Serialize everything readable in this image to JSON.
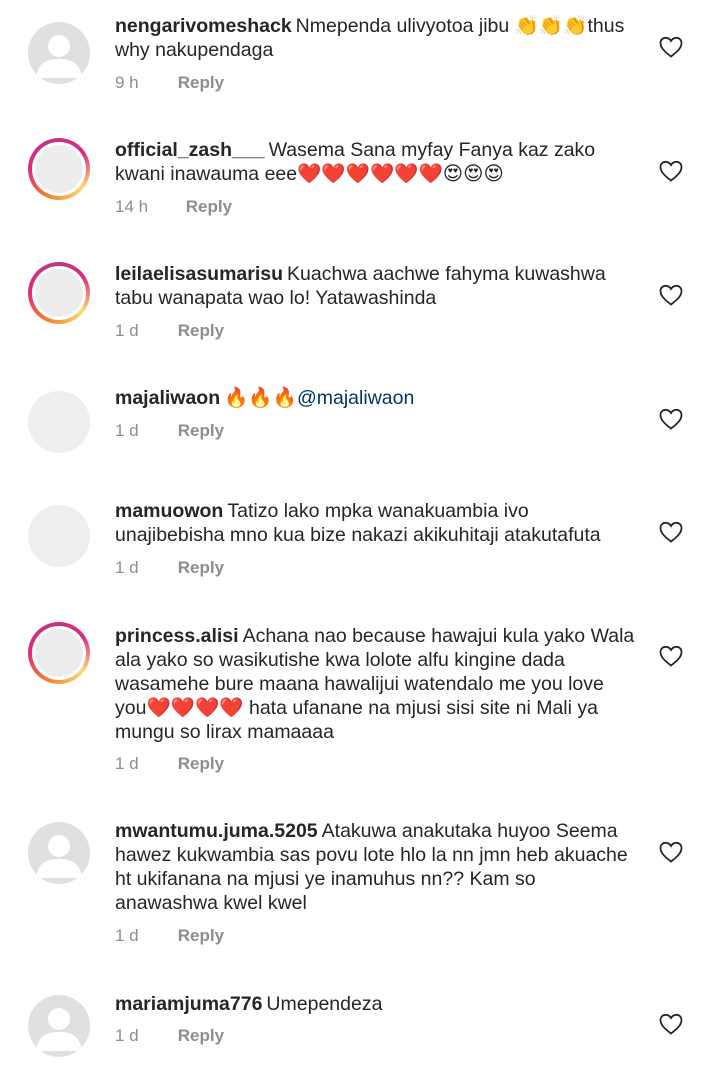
{
  "comments": [
    {
      "username": "nengarivomeshack",
      "text": "Nmependa ulivyotoa jibu 👏👏👏thus why nakupendaga",
      "time": "9 h",
      "reply": "Reply"
    },
    {
      "username": "official_zash___",
      "text": "Wasema Sana myfay Fanya kaz zako kwani inawauma eee❤️❤️❤️❤️❤️❤️😍😍😍",
      "time": "14 h",
      "reply": "Reply"
    },
    {
      "username": "leilaelisasumarisu",
      "text": "Kuachwa aachwe fahyma kuwashwa tabu wanapata wao lo! Yatawashinda",
      "time": "1 d",
      "reply": "Reply"
    },
    {
      "username": "majaliwaon",
      "text": "🔥🔥🔥",
      "mention": "@majaliwaon",
      "time": "1 d",
      "reply": "Reply"
    },
    {
      "username": "mamuowon",
      "text": "Tatizo lako mpka wanakuambia ivo unajibebisha mno kua bize nakazi akikuhitaji atakutafuta",
      "time": "1 d",
      "reply": "Reply"
    },
    {
      "username": "princess.alisi",
      "text": "Achana nao because hawajui kula yako Wala ala yako so wasikutishe kwa lolote alfu kingine dada wasamehe bure maana hawalijui watendalo me you love you❤️❤️❤️❤️ hata ufanane na mjusi sisi site ni Mali ya mungu so lirax mamaaaa",
      "time": "1 d",
      "reply": "Reply"
    },
    {
      "username": "mwantumu.juma.5205",
      "text": "Atakuwa anakutaka huyoo Seema hawez kukwambia sas povu lote hlo la nn jmn heb akuache ht ukifanana na mjusi ye inamuhus nn?? Kam so anawashwa kwel kwel",
      "time": "1 d",
      "reply": "Reply"
    },
    {
      "username": "mariamjuma776",
      "text": "Umependeza",
      "time": "1 d",
      "reply": "Reply"
    }
  ]
}
